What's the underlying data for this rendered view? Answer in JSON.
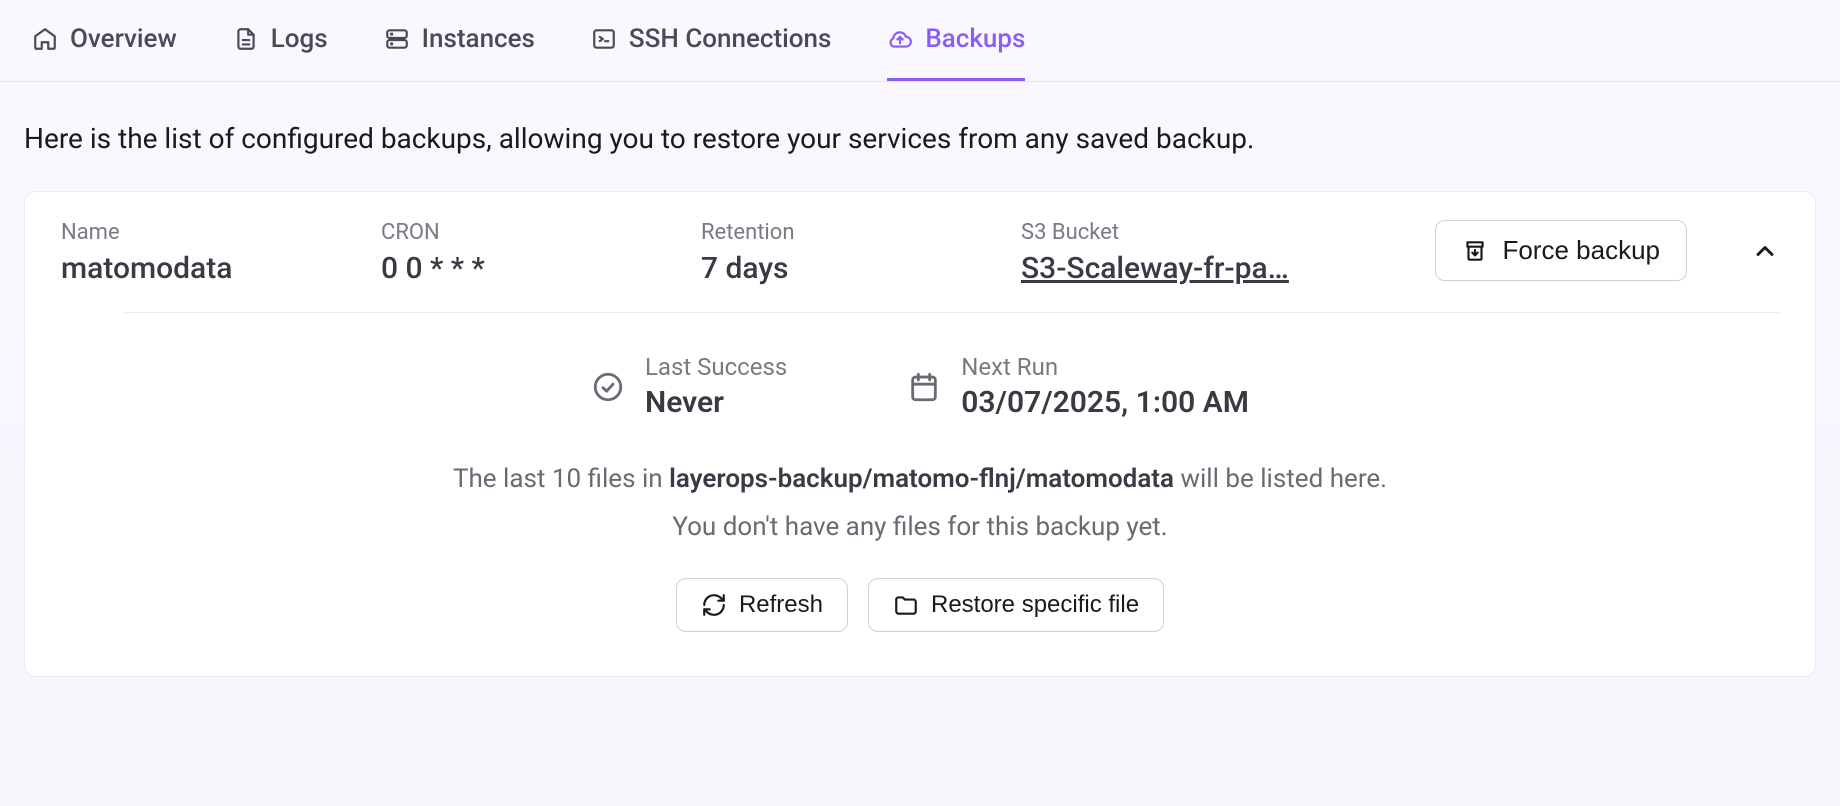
{
  "tabs": {
    "overview": "Overview",
    "logs": "Logs",
    "instances": "Instances",
    "ssh": "SSH Connections",
    "backups": "Backups"
  },
  "intro": "Here is the list of configured backups, allowing you to restore your services from any saved backup.",
  "backup": {
    "name_label": "Name",
    "name_value": "matomodata",
    "cron_label": "CRON",
    "cron_value": "0 0 * * *",
    "retention_label": "Retention",
    "retention_value": "7 days",
    "s3_label": "S3 Bucket",
    "s3_value": "S3-Scaleway-fr-pa…",
    "force_label": "Force backup",
    "last_success_label": "Last Success",
    "last_success_value": "Never",
    "next_run_label": "Next Run",
    "next_run_value": "03/07/2025, 1:00 AM",
    "list_prefix": "The last 10 files in ",
    "list_path": "layerops-backup/matomo-flnj/matomodata",
    "list_suffix": " will be listed here.",
    "empty_msg": "You don't have any files for this backup yet.",
    "refresh_label": "Refresh",
    "restore_label": "Restore specific file"
  }
}
